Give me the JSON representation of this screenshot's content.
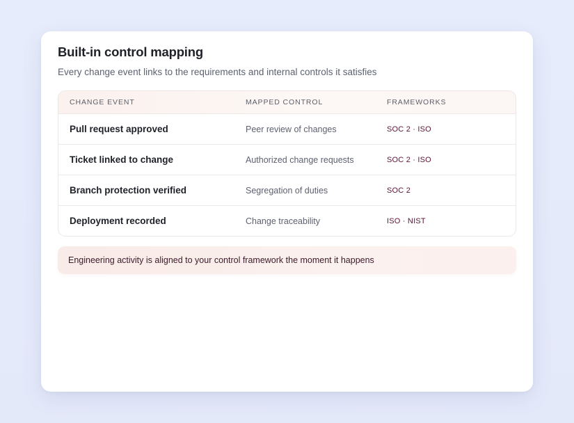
{
  "card": {
    "title": "Built-in control mapping",
    "subtitle": "Every change event links to the requirements and internal controls it satisfies"
  },
  "table": {
    "headers": {
      "event": "CHANGE EVENT",
      "control": "MAPPED CONTROL",
      "frameworks": "FRAMEWORKS"
    },
    "rows": [
      {
        "event": "Pull request approved",
        "control": "Peer review of changes",
        "frameworks": "SOC 2 · ISO"
      },
      {
        "event": "Ticket linked to change",
        "control": "Authorized change requests",
        "frameworks": "SOC 2 · ISO"
      },
      {
        "event": "Branch protection verified",
        "control": "Segregation of duties",
        "frameworks": "SOC 2"
      },
      {
        "event": "Deployment recorded",
        "control": "Change traceability",
        "frameworks": "ISO · NIST"
      }
    ]
  },
  "note": {
    "text": "Engineering activity is aligned to your control framework the moment it happens"
  },
  "colors": {
    "background": "#e6ecfb",
    "card": "#ffffff",
    "header_tint": "#fbf1ee",
    "framework_text": "#5a1436",
    "note_background": "#f9ebe7"
  }
}
